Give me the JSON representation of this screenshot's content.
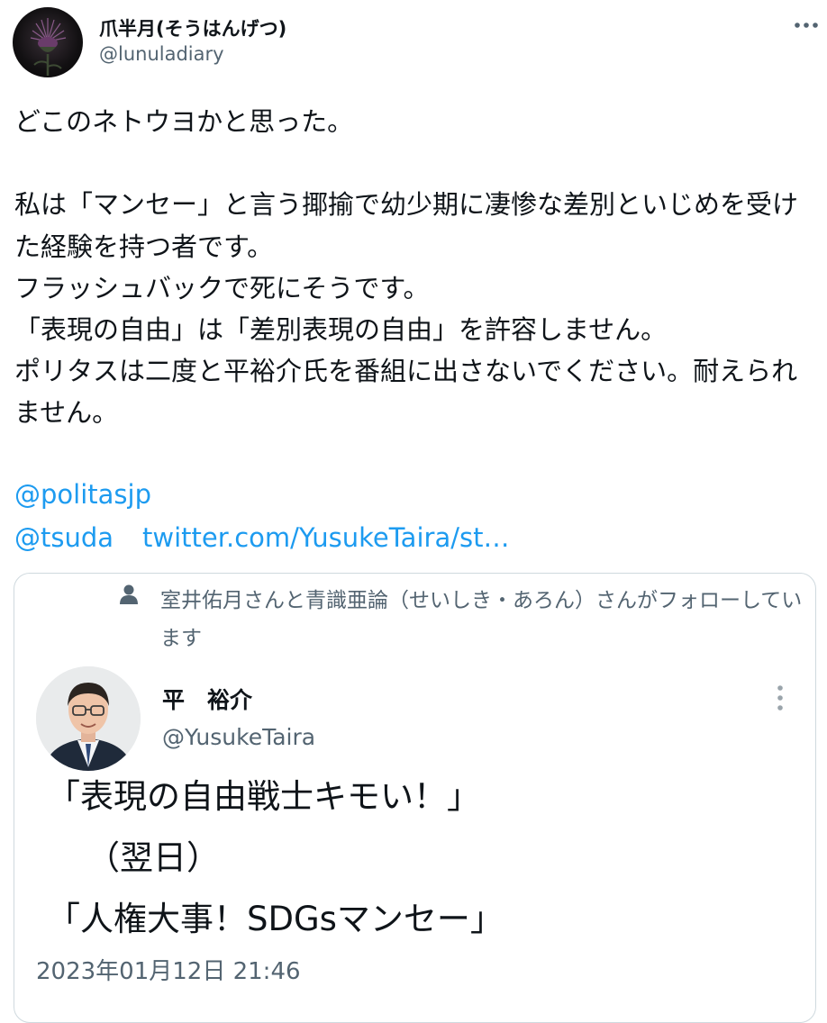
{
  "tweet": {
    "display_name": "爪半月(そうはんげつ)",
    "handle": "@lunuladiary",
    "body": "どこのネトウヨかと思った。\n\n私は「マンセー」と言う揶揄で幼少期に凄惨な差別といじめを受けた経験を持つ者です。\nフラッシュバックで死にそうです。\n「表現の自由」は「差別表現の自由」を許容しません。\nポリタスは二度と平裕介氏を番組に出さないでください。耐えられません。",
    "mentions": [
      "@politasjp",
      "@tsuda"
    ],
    "link_text": "twitter.com/YusukeTaira/st…"
  },
  "quoted": {
    "followed_by": "室井佑月さんと青識亜論（せいしき・あろん）さんがフォローしています",
    "display_name": "平　裕介",
    "handle": "@YusukeTaira",
    "lines": [
      "「表現の自由戦士キモい！」",
      "（翌日）",
      "「人権大事！SDGsマンセー」"
    ],
    "timestamp": "2023年01月12日 21:46"
  },
  "icons": {
    "more": "more-horizontal-icon",
    "more_vertical": "more-vertical-icon",
    "person": "person-icon"
  },
  "colors": {
    "link": "#1d9bf0",
    "secondary_text": "#536471",
    "border": "#cfd9de"
  }
}
